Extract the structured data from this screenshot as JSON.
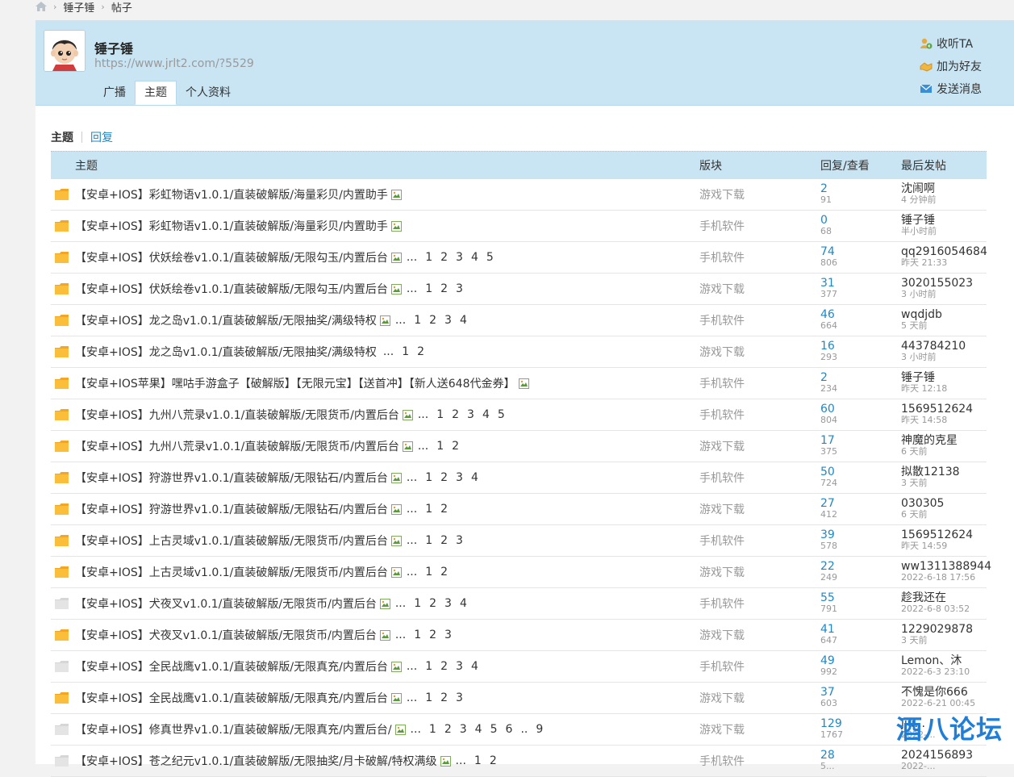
{
  "breadcrumb": {
    "items": [
      "锤子锤",
      "帖子"
    ],
    "separator": "›"
  },
  "profile": {
    "name": "锤子锤",
    "url": "https://www.jrlt2.com/?5529",
    "actions": [
      {
        "label": "收听TA",
        "icon": "follow-icon"
      },
      {
        "label": "加为好友",
        "icon": "add-friend-icon"
      },
      {
        "label": "发送消息",
        "icon": "message-icon"
      }
    ],
    "tabs": [
      {
        "label": "广播",
        "active": false
      },
      {
        "label": "主题",
        "active": true
      },
      {
        "label": "个人资料",
        "active": false
      }
    ]
  },
  "subtabs": {
    "current": "主题",
    "other": "回复"
  },
  "table": {
    "headers": {
      "title": "主题",
      "forum": "版块",
      "stats": "回复/查看",
      "last": "最后发帖"
    },
    "rows": [
      {
        "title": "【安卓+IOS】彩虹物语v1.0.1/直装破解版/海量彩贝/内置助手",
        "pages": [],
        "forum": "游戏下载",
        "replies": "2",
        "views": "91",
        "last_user": "沈闹啊",
        "last_time": "4 分钟前",
        "folder": "orange"
      },
      {
        "title": "【安卓+IOS】彩虹物语v1.0.1/直装破解版/海量彩贝/内置助手",
        "pages": [],
        "forum": "手机软件",
        "replies": "0",
        "views": "68",
        "last_user": "锤子锤",
        "last_time": "半小时前",
        "folder": "orange"
      },
      {
        "title": "【安卓+IOS】伏妖绘卷v1.0.1/直装破解版/无限勾玉/内置后台",
        "pages": [
          "1",
          "2",
          "3",
          "4",
          "5"
        ],
        "forum": "手机软件",
        "replies": "74",
        "views": "806",
        "last_user": "qq2916054684",
        "last_time": "昨天 21:33",
        "folder": "orange"
      },
      {
        "title": "【安卓+IOS】伏妖绘卷v1.0.1/直装破解版/无限勾玉/内置后台",
        "pages": [
          "1",
          "2",
          "3"
        ],
        "forum": "游戏下载",
        "replies": "31",
        "views": "377",
        "last_user": "3020155023",
        "last_time": "3 小时前",
        "folder": "orange"
      },
      {
        "title": "【安卓+IOS】龙之岛v1.0.1/直装破解版/无限抽奖/满级特权",
        "pages": [
          "1",
          "2",
          "3",
          "4"
        ],
        "forum": "手机软件",
        "replies": "46",
        "views": "664",
        "last_user": "wqdjdb",
        "last_time": "5 天前",
        "folder": "orange"
      },
      {
        "title": "【安卓+IOS】龙之岛v1.0.1/直装破解版/无限抽奖/满级特权",
        "pages": [
          "1",
          "2"
        ],
        "noimg": true,
        "forum": "游戏下载",
        "replies": "16",
        "views": "293",
        "last_user": "443784210",
        "last_time": "3 小时前",
        "folder": "orange"
      },
      {
        "title": "【安卓+IOS苹果】嘿咕手游盒子【破解版】【无限元宝】【送首冲】【新人送648代金券】",
        "pages": [],
        "forum": "手机软件",
        "replies": "2",
        "views": "234",
        "last_user": "锤子锤",
        "last_time": "昨天 12:18",
        "folder": "orange"
      },
      {
        "title": "【安卓+IOS】九州八荒录v1.0.1/直装破解版/无限货币/内置后台",
        "pages": [
          "1",
          "2",
          "3",
          "4",
          "5"
        ],
        "forum": "手机软件",
        "replies": "60",
        "views": "804",
        "last_user": "1569512624",
        "last_time": "昨天 14:58",
        "folder": "orange"
      },
      {
        "title": "【安卓+IOS】九州八荒录v1.0.1/直装破解版/无限货币/内置后台",
        "pages": [
          "1",
          "2"
        ],
        "forum": "游戏下载",
        "replies": "17",
        "views": "375",
        "last_user": "神魔的克星",
        "last_time": "6 天前",
        "folder": "orange"
      },
      {
        "title": "【安卓+IOS】狩游世界v1.0.1/直装破解版/无限钻石/内置后台",
        "pages": [
          "1",
          "2",
          "3",
          "4"
        ],
        "forum": "手机软件",
        "replies": "50",
        "views": "724",
        "last_user": "拟散12138",
        "last_time": "3 天前",
        "folder": "orange"
      },
      {
        "title": "【安卓+IOS】狩游世界v1.0.1/直装破解版/无限钻石/内置后台",
        "pages": [
          "1",
          "2"
        ],
        "forum": "游戏下载",
        "replies": "27",
        "views": "412",
        "last_user": "030305",
        "last_time": "6 天前",
        "folder": "orange"
      },
      {
        "title": "【安卓+IOS】上古灵域v1.0.1/直装破解版/无限货币/内置后台",
        "pages": [
          "1",
          "2",
          "3"
        ],
        "forum": "手机软件",
        "replies": "39",
        "views": "578",
        "last_user": "1569512624",
        "last_time": "昨天 14:59",
        "folder": "orange"
      },
      {
        "title": "【安卓+IOS】上古灵域v1.0.1/直装破解版/无限货币/内置后台",
        "pages": [
          "1",
          "2"
        ],
        "forum": "游戏下载",
        "replies": "22",
        "views": "249",
        "last_user": "ww1311388944",
        "last_time": "2022-6-18 17:56",
        "folder": "orange"
      },
      {
        "title": "【安卓+IOS】犬夜叉v1.0.1/直装破解版/无限货币/内置后台",
        "pages": [
          "1",
          "2",
          "3",
          "4"
        ],
        "forum": "手机软件",
        "replies": "55",
        "views": "791",
        "last_user": "趁我还在",
        "last_time": "2022-6-8 03:52",
        "folder": "gray"
      },
      {
        "title": "【安卓+IOS】犬夜叉v1.0.1/直装破解版/无限货币/内置后台",
        "pages": [
          "1",
          "2",
          "3"
        ],
        "forum": "游戏下载",
        "replies": "41",
        "views": "647",
        "last_user": "1229029878",
        "last_time": "3 天前",
        "folder": "orange"
      },
      {
        "title": "【安卓+IOS】全民战鹰v1.0.1/直装破解版/无限真充/内置后台",
        "pages": [
          "1",
          "2",
          "3",
          "4"
        ],
        "forum": "手机软件",
        "replies": "49",
        "views": "992",
        "last_user": "Lemon、沐",
        "last_time": "2022-6-3 23:10",
        "folder": "gray"
      },
      {
        "title": "【安卓+IOS】全民战鹰v1.0.1/直装破解版/无限真充/内置后台",
        "pages": [
          "1",
          "2",
          "3"
        ],
        "forum": "游戏下载",
        "replies": "37",
        "views": "603",
        "last_user": "不愧是你666",
        "last_time": "2022-6-21 00:45",
        "folder": "orange"
      },
      {
        "title": "【安卓+IOS】修真世界v1.0.1/直装破解版/无限真充/内置后台/",
        "pages": [
          "1",
          "2",
          "3",
          "4",
          "5",
          "6",
          "..",
          "9"
        ],
        "forum": "游戏下载",
        "replies": "129",
        "views": "1767",
        "last_user": "jiu...",
        "last_time": "2022-...",
        "folder": "gray"
      },
      {
        "title": "【安卓+IOS】苍之纪元v1.0.1/直装破解版/无限抽奖/月卡破解/特权满级",
        "pages": [
          "1",
          "2"
        ],
        "forum": "手机软件",
        "replies": "28",
        "views": "5...",
        "last_user": "2024156893",
        "last_time": "2022-...",
        "folder": "gray"
      }
    ]
  },
  "watermark": "酒八论坛"
}
